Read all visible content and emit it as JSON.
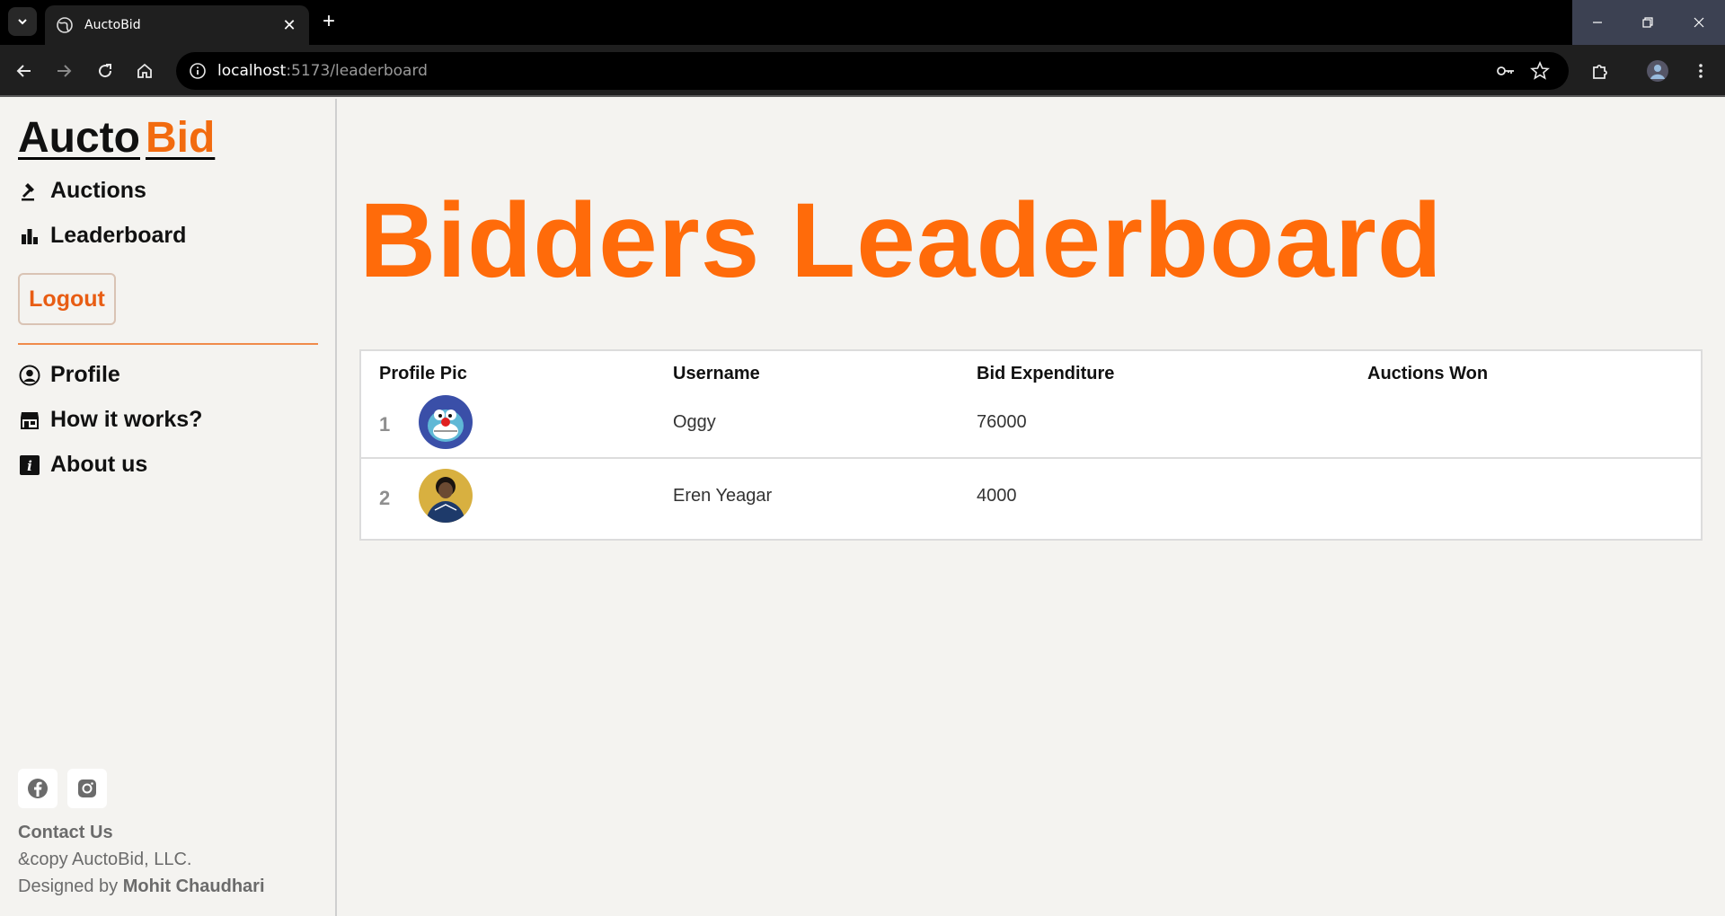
{
  "browser": {
    "tab_title": "AuctoBid",
    "url_host": "localhost",
    "url_path": ":5173/leaderboard"
  },
  "sidebar": {
    "logo_part1": "Aucto",
    "logo_part2": "Bid",
    "nav": [
      {
        "label": "Auctions",
        "icon": "gavel-icon"
      },
      {
        "label": "Leaderboard",
        "icon": "bar-chart-icon"
      }
    ],
    "logout_label": "Logout",
    "secondary_nav": [
      {
        "label": "Profile",
        "icon": "user-circle-icon"
      },
      {
        "label": "How it works?",
        "icon": "shop-icon"
      },
      {
        "label": "About us",
        "icon": "info-icon"
      }
    ],
    "contact_label": "Contact Us",
    "copyright": "&copy AuctoBid, LLC.",
    "designed_prefix": "Designed by ",
    "designer": "Mohit Chaudhari"
  },
  "main": {
    "title": "Bidders Leaderboard",
    "columns": [
      "Profile Pic",
      "Username",
      "Bid Expenditure",
      "Auctions Won"
    ],
    "rows": [
      {
        "rank": "1",
        "username": "Oggy",
        "bid_expenditure": "76000",
        "auctions_won": ""
      },
      {
        "rank": "2",
        "username": "Eren Yeagar",
        "bid_expenditure": "4000",
        "auctions_won": ""
      }
    ]
  },
  "colors": {
    "accent": "#ff6b0a",
    "logout": "#e85d14",
    "background": "#f4f3f0"
  }
}
